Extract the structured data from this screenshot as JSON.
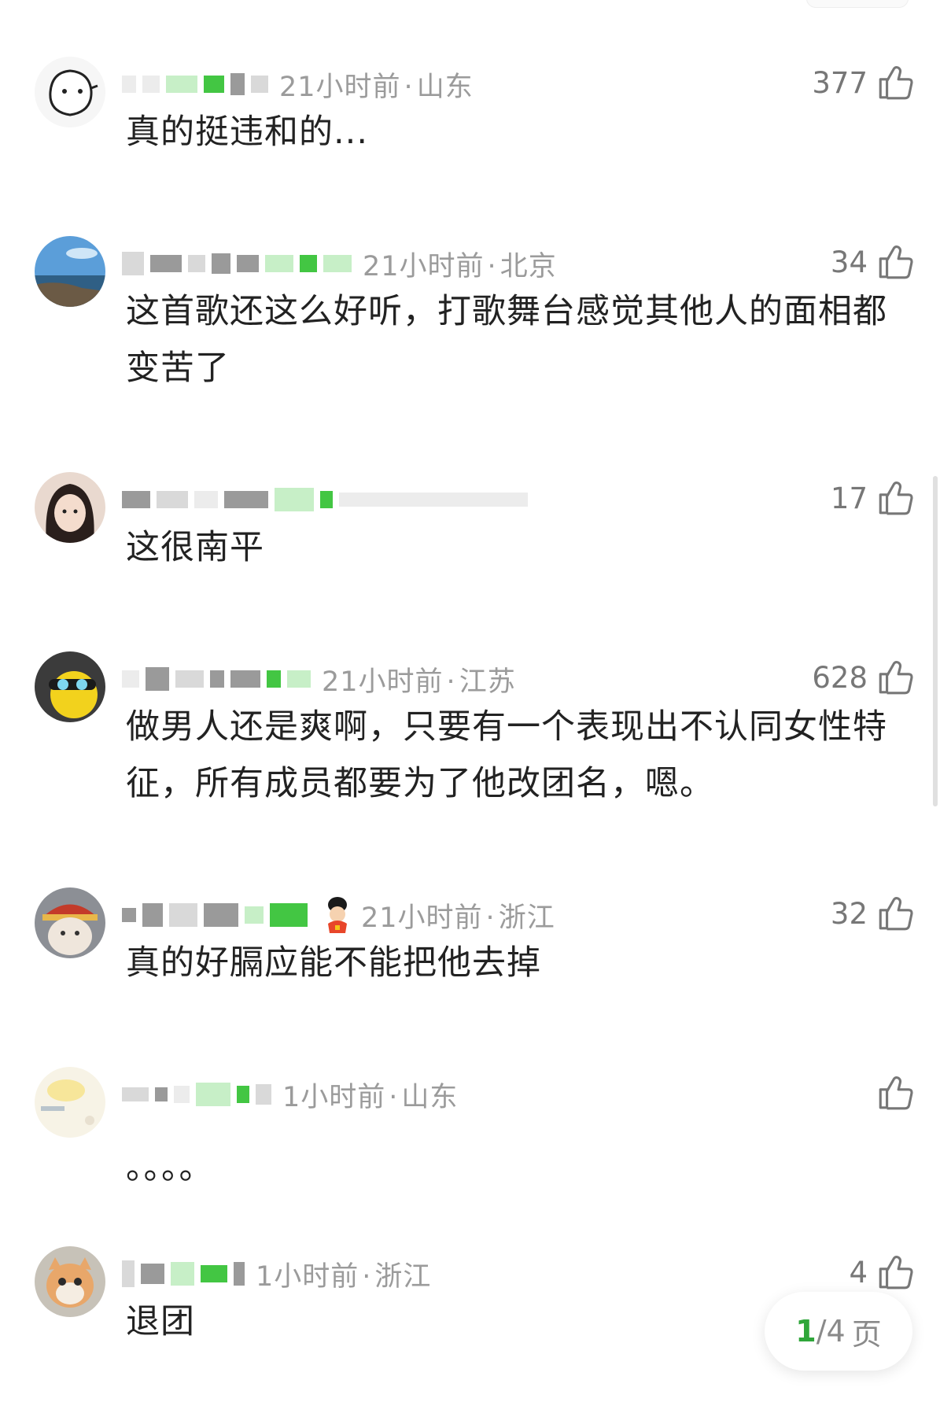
{
  "comments": [
    {
      "time": "21小时前",
      "location": "山东",
      "likes": "377",
      "text": "真的挺违和的..."
    },
    {
      "time": "21小时前",
      "location": "北京",
      "likes": "34",
      "text": "这首歌还这么好听，打歌舞台感觉其他人的面相都变苦了"
    },
    {
      "time": "",
      "location": "",
      "likes": "17",
      "text": "这很南平"
    },
    {
      "time": "21小时前",
      "location": "江苏",
      "likes": "628",
      "text": "做男人还是爽啊，只要有一个表现出不认同女性特征，所有成员都要为了他改团名，嗯。"
    },
    {
      "time": "21小时前",
      "location": "浙江",
      "likes": "32",
      "text": "真的好膈应能不能把他去掉"
    },
    {
      "time": "1小时前",
      "location": "山东",
      "likes": "",
      "text": "。。。。"
    },
    {
      "time": "1小时前",
      "location": "浙江",
      "likes": "4",
      "text": "退团"
    }
  ],
  "separator": "·",
  "pager": {
    "current": "1",
    "total": "/4",
    "suffix": "页"
  },
  "icons": {
    "like": "thumbs-up-icon",
    "medal": "medal-icon"
  },
  "colors": {
    "accent": "#2fa63a",
    "meta": "#9b9b9b"
  }
}
